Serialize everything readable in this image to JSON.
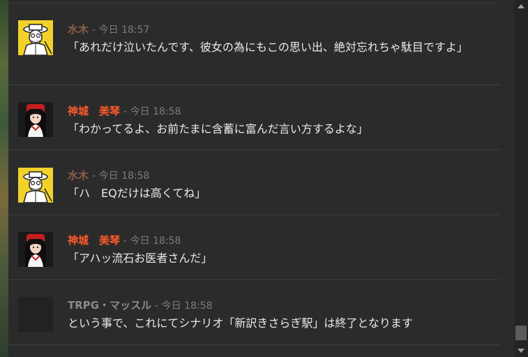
{
  "messages": [
    {
      "author": "水木",
      "author_color": "#8b5e4a",
      "separator": "-",
      "timestamp": "今日 18:57",
      "text": "「あれだけ泣いたんです、彼女の為にもこの思い出、絶対忘れちゃ駄目ですよ」",
      "avatar": "sketch-man-avatar"
    },
    {
      "author": "神城　美琴",
      "author_color": "#ff5a2a",
      "separator": "-",
      "timestamp": "今日 18:58",
      "text": "「わかってるよ、お前たまに含蓄に富んだ言い方するよな」",
      "avatar": "anime-girl-avatar"
    },
    {
      "author": "水木",
      "author_color": "#8b5e4a",
      "separator": "-",
      "timestamp": "今日 18:58",
      "text": "「ハ　EQだけは高くてね」",
      "avatar": "sketch-man-avatar"
    },
    {
      "author": "神城　美琴",
      "author_color": "#ff5a2a",
      "separator": "-",
      "timestamp": "今日 18:58",
      "text": "「アハッ流石お医者さんだ」",
      "avatar": "anime-girl-avatar"
    },
    {
      "author": "TRPG・マッスル",
      "author_color": "#8a8a8a",
      "separator": "-",
      "timestamp": "今日 18:58",
      "text": "という事で、これにてシナリオ「新訳きさらぎ駅」は終了となります",
      "avatar": "blank-avatar"
    }
  ],
  "scrollbar": {
    "up_icon": "chevron-up-icon",
    "down_icon": "chevron-down-icon",
    "thumb_color": "#5c5c5c"
  }
}
